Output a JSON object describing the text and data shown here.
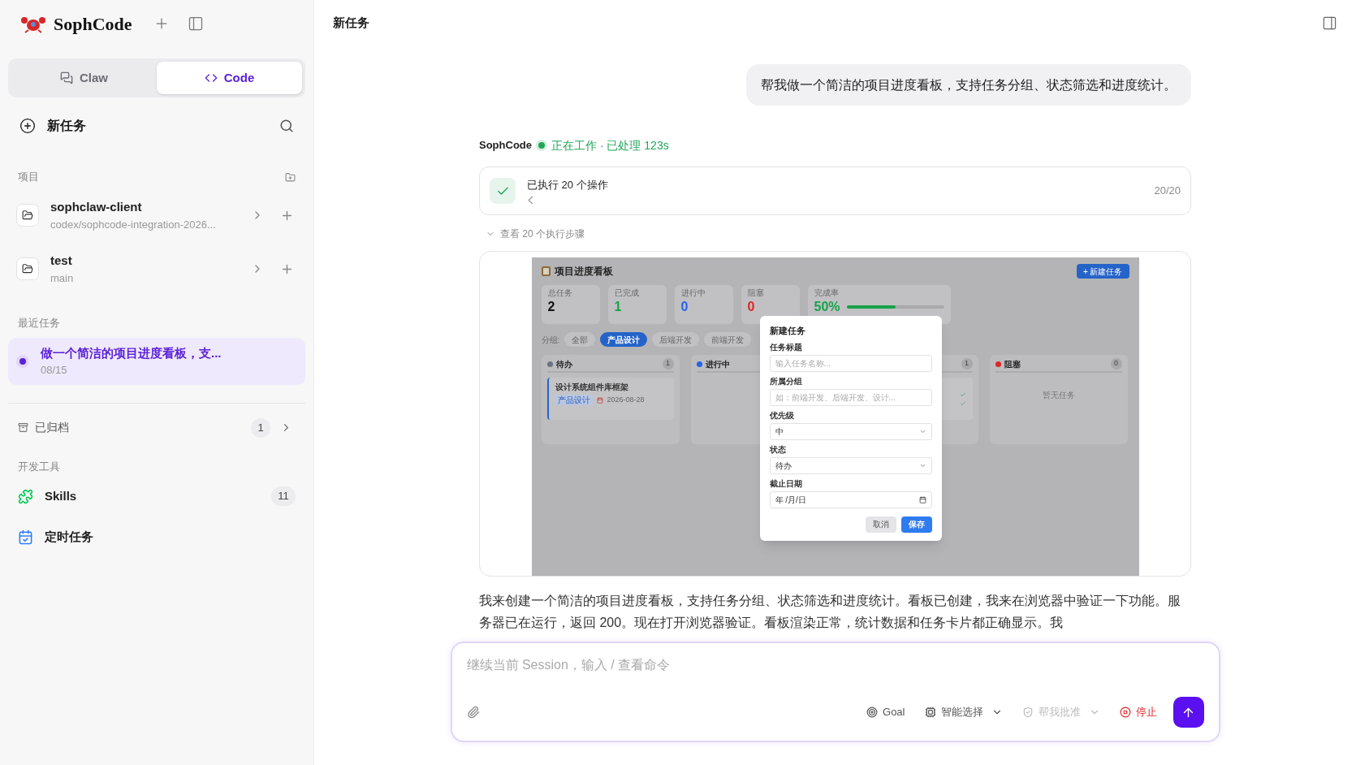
{
  "sidebar": {
    "brand": "SophCode",
    "mode_tabs": [
      {
        "kind": "chat",
        "label": "Claw",
        "selected": false
      },
      {
        "kind": "code",
        "label": "Code",
        "selected": true
      }
    ],
    "new_task": "新任务",
    "projects_header": "项目",
    "projects": [
      {
        "name": "sophclaw-client",
        "branch": "codex/sophcode-integration-2026..."
      },
      {
        "name": "test",
        "branch": "main"
      }
    ],
    "recent_header": "最近任务",
    "recent_tasks": [
      {
        "title": "做一个简洁的项目进度看板，支...",
        "date": "08/15",
        "selected": true
      }
    ],
    "archived": {
      "label": "已归档",
      "count": "1"
    },
    "tools_header": "开发工具",
    "tools": [
      {
        "kind": "skills",
        "label": "Skills",
        "count": "11"
      },
      {
        "kind": "schedule",
        "label": "定时任务"
      }
    ]
  },
  "header": {
    "title": "新任务"
  },
  "chat": {
    "user_message": "帮我做一个简洁的项目进度看板，支持任务分组、状态筛选和进度统计。",
    "agent": {
      "name": "SophCode",
      "status": "正在工作 · 已处理 123s"
    },
    "operations": {
      "title": "已执行 20 个操作",
      "done": true,
      "step_count": "20/20",
      "steps_link": "查看 20 个执行步骤"
    },
    "screenshot": {
      "title": "项目进度看板",
      "new_button": "+ 新建任务",
      "stats": [
        {
          "label": "总任务",
          "value": "2",
          "color": "#111111"
        },
        {
          "label": "已完成",
          "value": "1",
          "color": "#16a34a"
        },
        {
          "label": "进行中",
          "value": "0",
          "color": "#2563eb"
        },
        {
          "label": "阻塞",
          "value": "0",
          "color": "#dc2626"
        },
        {
          "label": "完成率",
          "value": "50%",
          "color": "#16a34a",
          "level": 0.5
        }
      ],
      "group_label": "分组:",
      "groups": [
        {
          "label": "全部",
          "selected": false
        },
        {
          "label": "产品设计",
          "selected": true
        },
        {
          "label": "后端开发",
          "selected": false
        },
        {
          "label": "前端开发",
          "selected": false
        }
      ],
      "columns": [
        {
          "title": "待办",
          "color": "#6b7280",
          "count": "1",
          "cards": [
            {
              "kind": "full",
              "title": "设计系统组件库框架",
              "tag": "产品设计",
              "date": "2026-08-28"
            }
          ]
        },
        {
          "title": "进行中",
          "color": "#2563eb"
        },
        {
          "count": "1",
          "cards": [
            {
              "kind": "covered"
            }
          ]
        },
        {
          "title": "阻塞",
          "color": "#dc2626",
          "count": "0",
          "empty": "暂无任务"
        }
      ],
      "dialog": {
        "title": "新建任务",
        "fields": [
          {
            "kind": "text",
            "label": "任务标题",
            "placeholder": "输入任务名称..."
          },
          {
            "kind": "text",
            "label": "所属分组",
            "placeholder": "如：前端开发、后端开发、设计..."
          },
          {
            "kind": "select",
            "label": "优先级",
            "value": "中"
          },
          {
            "kind": "select",
            "label": "状态",
            "value": "待办"
          },
          {
            "kind": "date",
            "label": "截止日期",
            "value": "年 /月/日"
          }
        ],
        "buttons": [
          {
            "kind": "secondary",
            "label": "取消"
          },
          {
            "kind": "primary",
            "label": "保存"
          }
        ]
      }
    },
    "reply": "我来创建一个简洁的项目进度看板，支持任务分组、状态筛选和进度统计。看板已创建，我来在浏览器中验证一下功能。服务器已在运行，返回 200。现在打开浏览器验证。看板渲染正常，统计数据和任务卡片都正确显示。我"
  },
  "composer": {
    "placeholder": "继续当前 Session，输入 / 查看命令",
    "actions": [
      {
        "kind": "goal",
        "label": "Goal",
        "disabled": false,
        "dropdown": false
      },
      {
        "kind": "model",
        "label": "智能选择",
        "disabled": false,
        "dropdown": true
      },
      {
        "kind": "approve",
        "label": "帮我批准",
        "disabled": true,
        "dropdown": true
      },
      {
        "kind": "stop",
        "label": "停止",
        "disabled": false,
        "dropdown": false
      }
    ]
  }
}
